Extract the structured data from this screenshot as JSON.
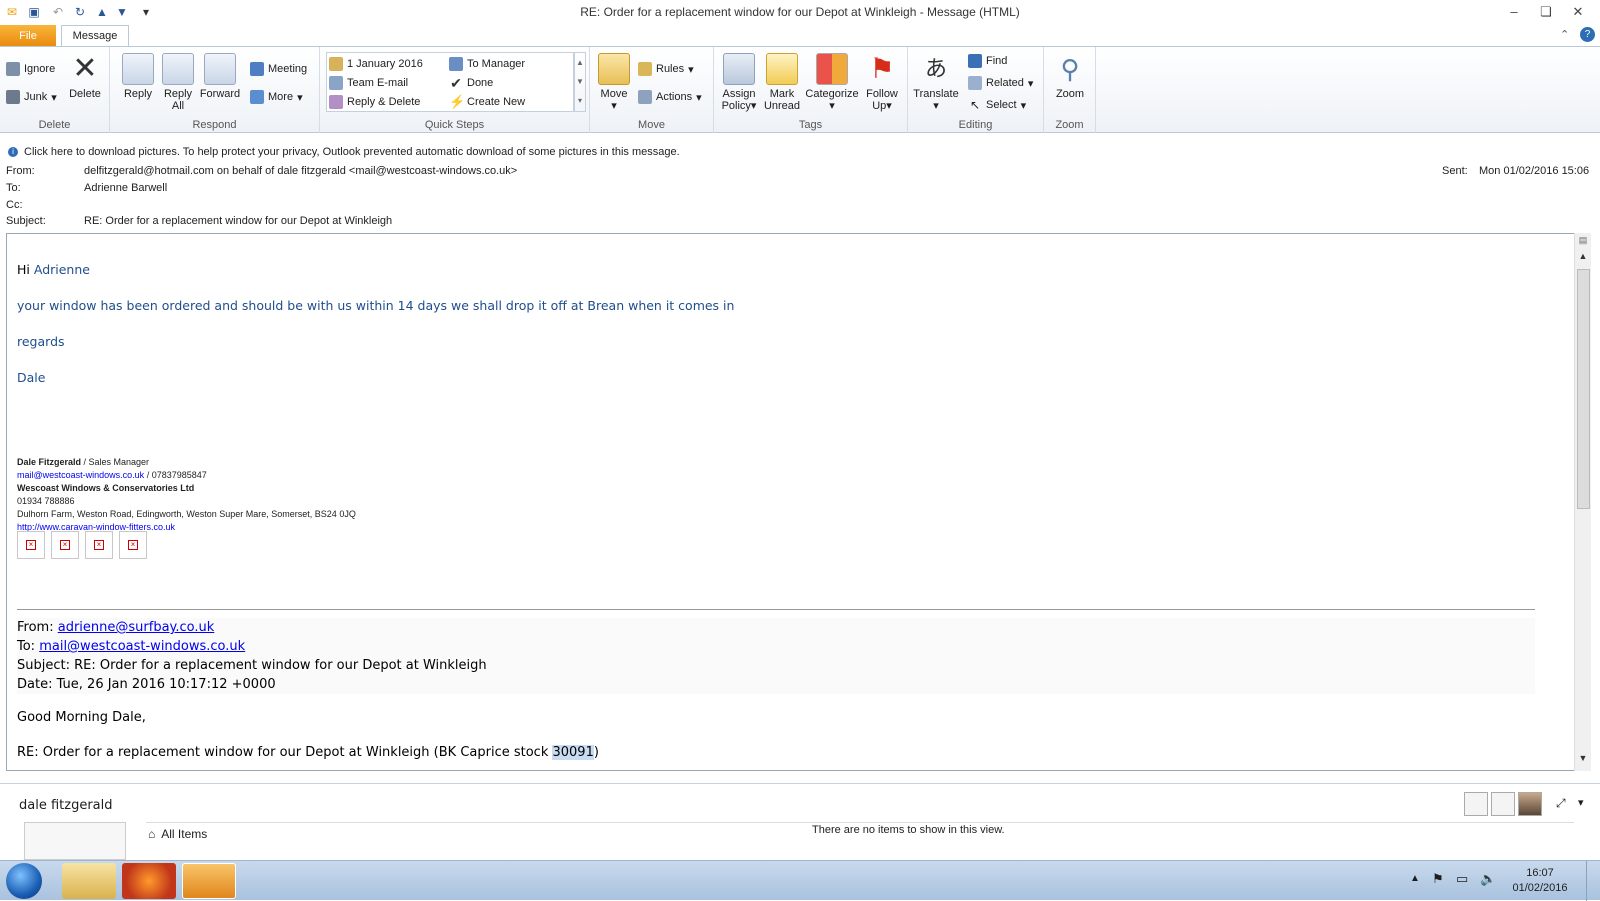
{
  "window": {
    "title": "RE: Order for a replacement window for our Depot at Winkleigh  -  Message (HTML)",
    "minimize": "–",
    "restore": "❏",
    "close": "✕"
  },
  "tabs": {
    "file": "File",
    "message": "Message"
  },
  "ribbon": {
    "delete_group": {
      "label": "Delete",
      "ignore": "Ignore",
      "junk": "Junk",
      "delete": "Delete"
    },
    "respond_group": {
      "label": "Respond",
      "reply": "Reply",
      "reply_all_1": "Reply",
      "reply_all_2": "All",
      "forward": "Forward",
      "meeting": "Meeting",
      "more": "More"
    },
    "quicksteps_group": {
      "label": "Quick Steps",
      "items": [
        "1 January 2016",
        "To Manager",
        "Team E-mail",
        "Done",
        "Reply & Delete",
        "Create New"
      ]
    },
    "move_group": {
      "label": "Move",
      "move": "Move",
      "rules": "Rules",
      "actions": "Actions"
    },
    "tags_group": {
      "label": "Tags",
      "assign_1": "Assign",
      "assign_2": "Policy",
      "mark_1": "Mark",
      "mark_2": "Unread",
      "categorize": "Categorize",
      "follow_1": "Follow",
      "follow_2": "Up"
    },
    "editing_group": {
      "label": "Editing",
      "translate": "Translate",
      "find": "Find",
      "related": "Related",
      "select": "Select"
    },
    "zoom_group": {
      "label": "Zoom",
      "zoom": "Zoom"
    }
  },
  "infobar": {
    "text": "Click here to download pictures. To help protect your privacy, Outlook prevented automatic download of some pictures in this message."
  },
  "header": {
    "from_label": "From:",
    "from": "delfitzgerald@hotmail.com on behalf of dale fitzgerald <mail@westcoast-windows.co.uk>",
    "to_label": "To:",
    "to": "Adrienne Barwell",
    "cc_label": "Cc:",
    "cc": "",
    "subject_label": "Subject:",
    "subject": "RE: Order for a replacement window for our Depot at Winkleigh",
    "sent_label": "Sent:",
    "sent": "Mon 01/02/2016 15:06"
  },
  "body": {
    "greeting_hi": "Hi",
    "greeting_name": "Adrienne",
    "line1": "your window has been ordered and should be with us within 14 days we shall drop it off at Brean when it comes in",
    "line2": "regards",
    "line3": "Dale",
    "signature": {
      "name": "Dale Fitzgerald",
      "role": " / Sales Manager",
      "email": "mail@westcoast-windows.co.uk",
      "phone_mobile": " / 07837985847",
      "company": "Wescoast Windows & Conservatories Ltd",
      "phone": "01934 788886",
      "address": "Dulhorn Farm, Weston Road, Edingworth, Weston Super Mare, Somerset, BS24 0JQ",
      "website": "http://www.caravan-window-fitters.co.uk"
    },
    "quoted": {
      "from_label": "From: ",
      "from": "adrienne@surfbay.co.uk",
      "to_label": "To: ",
      "to": "mail@westcoast-windows.co.uk",
      "subject": "Subject: RE: Order for a replacement window for our Depot at Winkleigh",
      "date": "Date: Tue, 26 Jan 2016 10:17:12 +0000",
      "greeting": "Good Morning Dale,",
      "cutoff_line": "RE: Order for a replacement window for our Depot at Winkleigh (BK Caprice stock ",
      "cutoff_highlight": "30091",
      "cutoff_end": ")"
    }
  },
  "people_pane": {
    "name": "dale fitzgerald",
    "all_items": "All Items",
    "empty_message": "There are no items to show in this view."
  },
  "taskbar": {
    "time": "16:07",
    "date": "01/02/2016"
  }
}
